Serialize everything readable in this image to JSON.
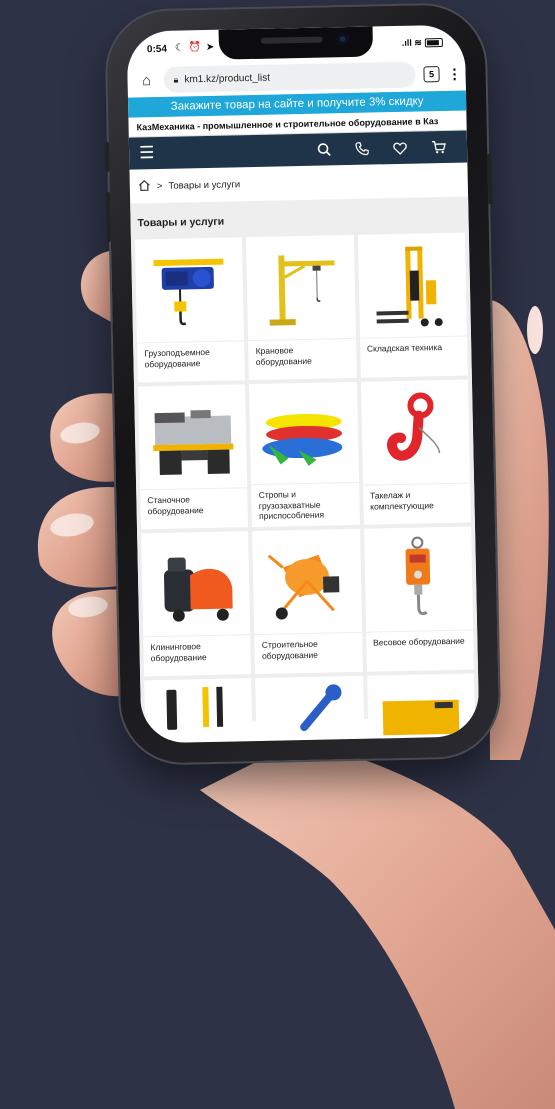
{
  "status": {
    "time": "0:54",
    "icons": "☾ ⏰ ➤",
    "right": ".ıll ≋"
  },
  "browser": {
    "url": "km1.kz/product_list",
    "tabs_count": "5",
    "menu": "⋮"
  },
  "promo": {
    "text": "Закажите товар на сайте и получите 3% скидку"
  },
  "tagline": "КазМеханика - промышленное и строительное оборудование в Каз",
  "nav": {
    "icons": [
      "menu-icon",
      "search-icon",
      "phone-icon",
      "heart-icon",
      "cart-icon"
    ]
  },
  "breadcrumb": {
    "separator": ">",
    "current": "Товары и услуги"
  },
  "section": {
    "title": "Товары и услуги"
  },
  "products": [
    {
      "label": "Грузоподъемное оборудование",
      "icon": "hoist-icon"
    },
    {
      "label": "Крановое оборудование",
      "icon": "crane-icon"
    },
    {
      "label": "Складская техника",
      "icon": "stacker-icon"
    },
    {
      "label": "Станочное оборудование",
      "icon": "lathe-icon"
    },
    {
      "label": "Стропы и грузозахватные приспособления",
      "icon": "slings-icon"
    },
    {
      "label": "Такелаж и комплектующие",
      "icon": "hook-icon"
    },
    {
      "label": "Клининговое оборудование",
      "icon": "scrubber-icon"
    },
    {
      "label": "Строительное оборудование",
      "icon": "mixer-icon"
    },
    {
      "label": "Весовое оборудование",
      "icon": "scale-icon"
    }
  ],
  "colors": {
    "promo": "#1ea7d8",
    "navbar": "#1f3448",
    "background": "#2e3246"
  }
}
